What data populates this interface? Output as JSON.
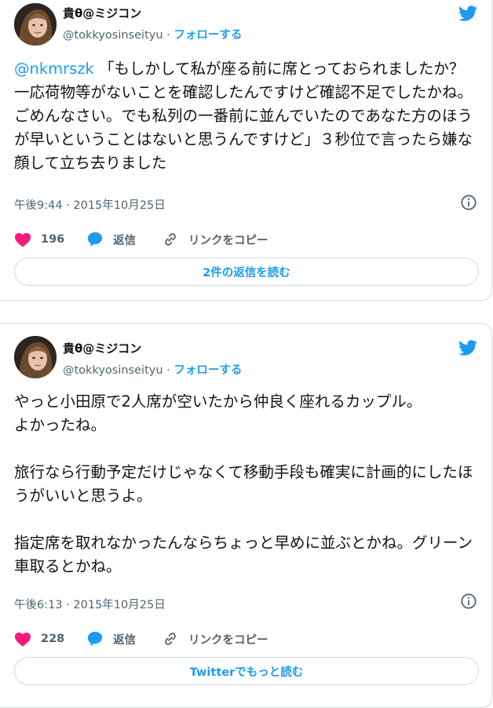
{
  "tweets": [
    {
      "author_name": "貴θ@ミジコン",
      "handle": "@tokkyosinseityu",
      "separator": " · ",
      "follow_label": "フォローする",
      "mention": "@nkmrszk",
      "text": " 「もしかして私が座る前に席とっておられましたか？一応荷物等がないことを確認したんですけど確認不足でしたかね。ごめんなさい。でも私列の一番前に並んでいたのであなた方のほうが早いということはないと思うんですけど」３秒位で言ったら嫌な顔して立ち去りました",
      "timestamp": "午後9:44 · 2015年10月25日",
      "like_count": "196",
      "reply_label": "返信",
      "copy_link_label": "リンクをコピー",
      "read_button_label": "2件の返信を読む"
    },
    {
      "author_name": "貴θ@ミジコン",
      "handle": "@tokkyosinseityu",
      "separator": " · ",
      "follow_label": "フォローする",
      "text": "やっと小田原で2人席が空いたから仲良く座れるカップル。\nよかったね。\n\n旅行なら行動予定だけじゃなくて移動手段も確実に計画的にしたほうがいいと思うよ。\n\n指定席を取れなかったんならちょっと早めに並ぶとかね。グリーン車取るとかね。",
      "timestamp": "午後6:13 · 2015年10月25日",
      "like_count": "228",
      "reply_label": "返信",
      "copy_link_label": "リンクをコピー",
      "read_button_label": "Twitterでもっと読む"
    }
  ],
  "colors": {
    "accent": "#1d9bf0",
    "like": "#f91880",
    "secondary_text": "#536471",
    "border": "#cfd9de"
  },
  "icons": [
    "twitter-bird-icon",
    "info-icon",
    "heart-icon",
    "reply-bubble-icon",
    "link-icon"
  ]
}
